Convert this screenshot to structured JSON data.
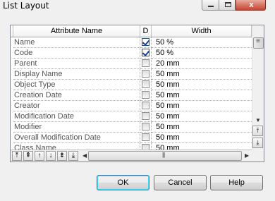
{
  "window": {
    "title": "List Layout",
    "close_label": "x"
  },
  "grid": {
    "columns": [
      "Attribute Name",
      "D",
      "Width"
    ],
    "rows": [
      {
        "name": "Name",
        "display": true,
        "width": "50 %"
      },
      {
        "name": "Code",
        "display": true,
        "width": "50 %"
      },
      {
        "name": "Parent",
        "display": false,
        "width": "20 mm"
      },
      {
        "name": "Display Name",
        "display": false,
        "width": "50 mm"
      },
      {
        "name": "Object Type",
        "display": false,
        "width": "50 mm"
      },
      {
        "name": "Creation Date",
        "display": false,
        "width": "50 mm"
      },
      {
        "name": "Creator",
        "display": false,
        "width": "50 mm"
      },
      {
        "name": "Modification Date",
        "display": false,
        "width": "50 mm"
      },
      {
        "name": "Modifier",
        "display": false,
        "width": "50 mm"
      },
      {
        "name": "Overall Modification Date",
        "display": false,
        "width": "50 mm"
      },
      {
        "name": "Class Name",
        "display": false,
        "width": "50 mm"
      }
    ]
  },
  "toolbar": {
    "move_top": "⤒",
    "move_page_up": "⇞",
    "move_up": "↑",
    "move_down": "↓",
    "move_page_down": "⇟",
    "move_bottom": "⤓"
  },
  "buttons": {
    "ok": "OK",
    "cancel": "Cancel",
    "help": "Help"
  }
}
